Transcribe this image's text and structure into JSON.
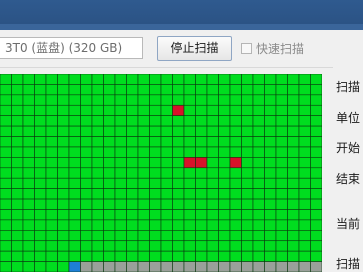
{
  "toolbar": {
    "disk_select_value": "3T0 (蓝盘)  (320 GB)",
    "stop_scan_label": "停止扫描",
    "quick_scan_label": "快速扫描",
    "quick_scan_checked": false
  },
  "scan_map": {
    "rows": 19,
    "cols": 28,
    "colors": {
      "ok": "#00dd1f",
      "bad": "#d8122a",
      "pending": "#9aa09a",
      "current": "#1e7fd6"
    },
    "bad_blocks": [
      {
        "row": 3,
        "col": 15
      },
      {
        "row": 8,
        "col": 16
      },
      {
        "row": 8,
        "col": 17
      },
      {
        "row": 8,
        "col": 20
      }
    ],
    "scanned_blocks": 510,
    "current_block": 510
  },
  "info_panel": {
    "labels": [
      "扫描",
      "单位",
      "开始",
      "结束",
      "当前",
      "扫描"
    ]
  },
  "theme": {
    "titlebar": "#2c5587",
    "grid_line": "#0a3a10"
  }
}
